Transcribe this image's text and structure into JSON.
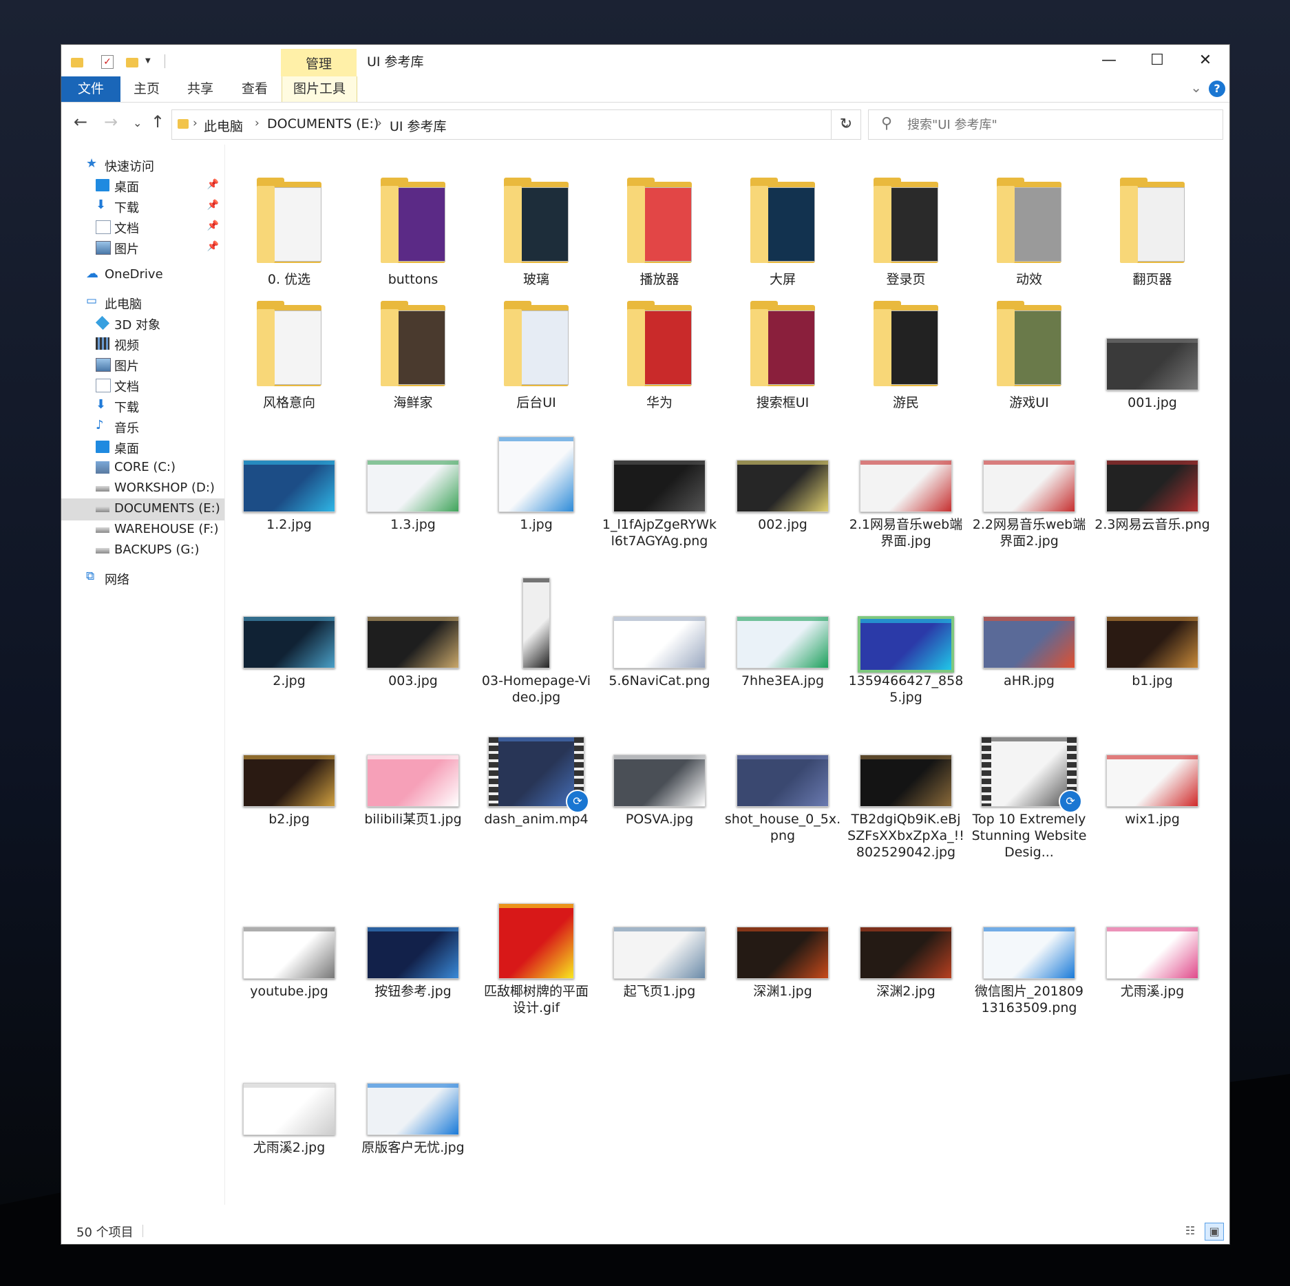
{
  "window": {
    "title": "UI 参考库",
    "context_tab": "管理",
    "controls": {
      "minimize": "—",
      "maximize": "☐",
      "close": "✕"
    }
  },
  "ribbon": {
    "tabs": [
      {
        "label": "文件"
      },
      {
        "label": "主页"
      },
      {
        "label": "共享"
      },
      {
        "label": "查看"
      },
      {
        "label": "图片工具"
      }
    ],
    "expand_glyph": "⌄",
    "help_glyph": "?"
  },
  "nav": {
    "back": "←",
    "forward": "→",
    "recent": "⌄",
    "up": "↑",
    "breadcrumb": [
      "此电脑",
      "DOCUMENTS (E:)",
      "UI 参考库"
    ],
    "breadcrumb_sep": "›",
    "refresh": "↻",
    "search_placeholder": "搜索\"UI 参考库\""
  },
  "sidebar": {
    "items": [
      {
        "label": "快速访问",
        "icon": "star-icon",
        "level": 0
      },
      {
        "label": "桌面",
        "icon": "desktop-icon",
        "level": 1,
        "pinned": true
      },
      {
        "label": "下载",
        "icon": "download-icon",
        "level": 1,
        "pinned": true
      },
      {
        "label": "文档",
        "icon": "document-icon",
        "level": 1,
        "pinned": true
      },
      {
        "label": "图片",
        "icon": "picture-icon",
        "level": 1,
        "pinned": true
      },
      {
        "label": "OneDrive",
        "icon": "cloud-icon",
        "level": 0
      },
      {
        "label": "此电脑",
        "icon": "computer-icon",
        "level": 0
      },
      {
        "label": "3D 对象",
        "icon": "cube-icon",
        "level": 1
      },
      {
        "label": "视频",
        "icon": "video-icon",
        "level": 1
      },
      {
        "label": "图片",
        "icon": "picture-icon",
        "level": 1
      },
      {
        "label": "文档",
        "icon": "document-icon",
        "level": 1
      },
      {
        "label": "下载",
        "icon": "download-icon",
        "level": 1
      },
      {
        "label": "音乐",
        "icon": "music-icon",
        "level": 1
      },
      {
        "label": "桌面",
        "icon": "desktop-icon",
        "level": 1
      },
      {
        "label": "CORE (C:)",
        "icon": "windows-drive-icon",
        "level": 1
      },
      {
        "label": "WORKSHOP (D:)",
        "icon": "drive-icon",
        "level": 1
      },
      {
        "label": "DOCUMENTS (E:)",
        "icon": "drive-icon",
        "level": 1,
        "selected": true
      },
      {
        "label": "WAREHOUSE (F:)",
        "icon": "drive-icon",
        "level": 1
      },
      {
        "label": "BACKUPS (G:)",
        "icon": "drive-icon",
        "level": 1
      },
      {
        "label": "网络",
        "icon": "network-icon",
        "level": 0
      }
    ],
    "pin_glyph": "📌"
  },
  "files": [
    {
      "name": "0. 优选",
      "kind": "folder",
      "paper": "#f4f4f4"
    },
    {
      "name": "buttons",
      "kind": "folder",
      "paper": "#5b2a86"
    },
    {
      "name": "玻璃",
      "kind": "folder",
      "paper": "#1d2d3a"
    },
    {
      "name": "播放器",
      "kind": "folder",
      "paper": "#e24646"
    },
    {
      "name": "大屏",
      "kind": "folder",
      "paper": "#12324f"
    },
    {
      "name": "登录页",
      "kind": "folder",
      "paper": "#2a2a2a"
    },
    {
      "name": "动效",
      "kind": "folder",
      "paper": "#9a9a9a"
    },
    {
      "name": "翻页器",
      "kind": "folder",
      "paper": "#f0f0f0"
    },
    {
      "name": "风格意向",
      "kind": "folder",
      "paper": "#f4f4f4"
    },
    {
      "name": "海鲜家",
      "kind": "folder",
      "paper": "#4a3a2e"
    },
    {
      "name": "后台UI",
      "kind": "folder",
      "paper": "#e6ecf4"
    },
    {
      "name": "华为",
      "kind": "folder",
      "paper": "#c92a2a"
    },
    {
      "name": "搜索框UI",
      "kind": "folder",
      "paper": "#8a1f3c"
    },
    {
      "name": "游民",
      "kind": "folder",
      "paper": "#222222"
    },
    {
      "name": "游戏UI",
      "kind": "folder",
      "paper": "#6a7a4a"
    },
    {
      "name": "001.jpg",
      "kind": "image",
      "bg": "#3a3a3a",
      "accent": "#777777"
    },
    {
      "name": "1.2.jpg",
      "kind": "image",
      "bg": "#1c4d86",
      "accent": "#2fb6e6"
    },
    {
      "name": "1.3.jpg",
      "kind": "image",
      "bg": "#f2f4f7",
      "accent": "#3fa45a"
    },
    {
      "name": "1.jpg",
      "kind": "image",
      "bg": "#f8f9fb",
      "accent": "#2e8bd8",
      "tall": true
    },
    {
      "name": "1_l1fAjpZgeRYWkl6t7AGYAg.png",
      "kind": "image",
      "bg": "#1a1a1a",
      "accent": "#555555"
    },
    {
      "name": "002.jpg",
      "kind": "image",
      "bg": "#262626",
      "accent": "#e0d070"
    },
    {
      "name": "2.1网易音乐web端界面.jpg",
      "kind": "image",
      "bg": "#f3f3f3",
      "accent": "#c62f2f"
    },
    {
      "name": "2.2网易音乐web端界面2.jpg",
      "kind": "image",
      "bg": "#f3f3f3",
      "accent": "#c62f2f"
    },
    {
      "name": "2.3网易云音乐.png",
      "kind": "image",
      "bg": "#222222",
      "accent": "#b03030"
    },
    {
      "name": "2.jpg",
      "kind": "image",
      "bg": "#102234",
      "accent": "#4aa0c8"
    },
    {
      "name": "003.jpg",
      "kind": "image",
      "bg": "#1e1e1e",
      "accent": "#caa86a"
    },
    {
      "name": "03-Homepage-Video.jpg",
      "kind": "image",
      "bg": "#efefef",
      "accent": "#222222",
      "long": true
    },
    {
      "name": "5.6NaviCat.png",
      "kind": "image",
      "bg": "#ffffff",
      "accent": "#9aa8c0"
    },
    {
      "name": "7hhe3EA.jpg",
      "kind": "image",
      "bg": "#eaf2f8",
      "accent": "#1ea05c"
    },
    {
      "name": "1359466427_8585.jpg",
      "kind": "image",
      "bg": "#2b3aa8",
      "accent": "#20c8e8",
      "border": "#7fc87f"
    },
    {
      "name": "aHR.jpg",
      "kind": "image",
      "bg": "#5a6a98",
      "accent": "#e05030"
    },
    {
      "name": "b1.jpg",
      "kind": "image",
      "bg": "#2a1a12",
      "accent": "#c88a3a"
    },
    {
      "name": "b2.jpg",
      "kind": "image",
      "bg": "#2a1a12",
      "accent": "#d0a040"
    },
    {
      "name": "bilibili某页1.jpg",
      "kind": "image",
      "bg": "#f6a0b8",
      "accent": "#ffffff"
    },
    {
      "name": "dash_anim.mp4",
      "kind": "video",
      "bg": "#283556",
      "accent": "#4a78c8"
    },
    {
      "name": "POSVA.jpg",
      "kind": "image",
      "bg": "#4a4f56",
      "accent": "#ffffff"
    },
    {
      "name": "shot_house_0_5x.png",
      "kind": "image",
      "bg": "#3a4870",
      "accent": "#6a7ab0"
    },
    {
      "name": "TB2dgiQb9iK.eBjSZFsXXbxZpXa_!!802529042.jpg",
      "kind": "image",
      "bg": "#141414",
      "accent": "#8a6a3a"
    },
    {
      "name": "Top 10 Extremely Stunning Website Desig...",
      "kind": "video",
      "bg": "#f4f4f4",
      "accent": "#444444"
    },
    {
      "name": "wix1.jpg",
      "kind": "image",
      "bg": "#f7f7f7",
      "accent": "#d02a2a"
    },
    {
      "name": "youtube.jpg",
      "kind": "image",
      "bg": "#ffffff",
      "accent": "#777777"
    },
    {
      "name": "按钮参考.jpg",
      "kind": "image",
      "bg": "#12214a",
      "accent": "#3a8ad8"
    },
    {
      "name": "匹敌椰树牌的平面设计.gif",
      "kind": "image",
      "bg": "#d81818",
      "accent": "#f8e820",
      "tall": true
    },
    {
      "name": "起飞页1.jpg",
      "kind": "image",
      "bg": "#f4f4f4",
      "accent": "#6a8aa8"
    },
    {
      "name": "深渊1.jpg",
      "kind": "image",
      "bg": "#241a14",
      "accent": "#c84a1a"
    },
    {
      "name": "深渊2.jpg",
      "kind": "image",
      "bg": "#241a14",
      "accent": "#b84020"
    },
    {
      "name": "微信图片_20180913163509.png",
      "kind": "image",
      "bg": "#f4f8fb",
      "accent": "#1a7ad8"
    },
    {
      "name": "尤雨溪.jpg",
      "kind": "image",
      "bg": "#ffffff",
      "accent": "#e04a8a"
    },
    {
      "name": "尤雨溪2.jpg",
      "kind": "image",
      "bg": "#ffffff",
      "accent": "#cccccc"
    },
    {
      "name": "原版客户无忧.jpg",
      "kind": "image",
      "bg": "#eef2f6",
      "accent": "#1a7ad8"
    }
  ],
  "status": {
    "count": "50 个项目",
    "details_view_glyph": "☷",
    "large_icons_glyph": "▣"
  },
  "colors": {
    "ribbon_file_tab": "#1a66b8",
    "context_tab": "#fff0a8",
    "selected_nav": "#dcdcdc"
  }
}
